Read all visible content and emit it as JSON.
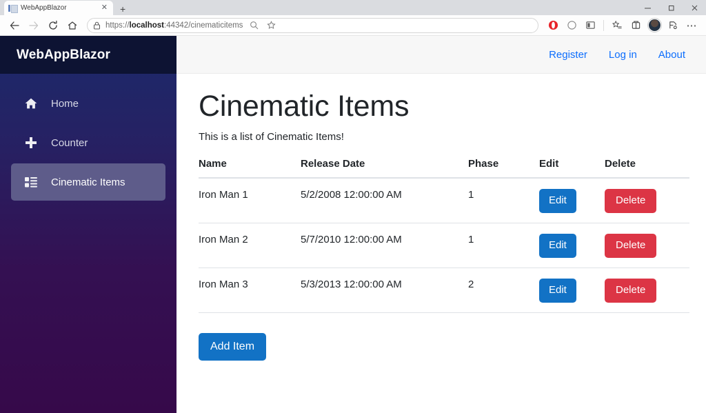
{
  "browser": {
    "tab": {
      "title": "WebAppBlazor",
      "close_label": "✕",
      "favicon": "document-icon"
    },
    "new_tab_label": "+",
    "window_controls": {
      "minimize": "minimize-icon",
      "maximize": "maximize-icon",
      "close": "close-icon"
    },
    "nav": {
      "back": "back-arrow-icon",
      "forward": "forward-arrow-icon",
      "refresh": "refresh-icon",
      "home": "home-icon"
    },
    "address": {
      "scheme": "https://",
      "host": "localhost",
      "rest": ":44342/cinematicitems",
      "full_url": "https://localhost:44342/cinematicitems",
      "lock": "lock-icon",
      "search_icon": "search-zoom-icon",
      "favorite_icon": "star-icon"
    },
    "extensions": [
      {
        "name": "opera-extension-icon",
        "color": "#E8242A"
      },
      {
        "name": "circle-extension-icon",
        "color": "#8a8a8a"
      },
      {
        "name": "panel-extension-icon",
        "color": "#5a5a5a"
      }
    ],
    "right_icons": [
      {
        "name": "collections-favorites-icon"
      },
      {
        "name": "browser-essentials-icon"
      },
      {
        "name": "profile-avatar"
      },
      {
        "name": "split-screen-icon"
      },
      {
        "name": "settings-more-icon",
        "label": "⋯"
      }
    ]
  },
  "app": {
    "brand": "WebAppBlazor",
    "topnav": [
      {
        "label": "Register",
        "name": "register-link"
      },
      {
        "label": "Log in",
        "name": "login-link"
      },
      {
        "label": "About",
        "name": "about-link"
      }
    ],
    "sidebar": {
      "items": [
        {
          "label": "Home",
          "icon": "house-icon",
          "active": false
        },
        {
          "label": "Counter",
          "icon": "plus-icon",
          "active": false
        },
        {
          "label": "Cinematic Items",
          "icon": "list-grid-icon",
          "active": true
        }
      ]
    },
    "page": {
      "title": "Cinematic Items",
      "subtitle": "This is a list of Cinematic Items!",
      "table": {
        "columns": [
          "Name",
          "Release Date",
          "Phase",
          "Edit",
          "Delete"
        ],
        "rows": [
          {
            "name": "Iron Man 1",
            "release_date": "5/2/2008 12:00:00 AM",
            "phase": "1",
            "edit": "Edit",
            "delete": "Delete"
          },
          {
            "name": "Iron Man 2",
            "release_date": "5/7/2010 12:00:00 AM",
            "phase": "1",
            "edit": "Edit",
            "delete": "Delete"
          },
          {
            "name": "Iron Man 3",
            "release_date": "5/3/2013 12:00:00 AM",
            "phase": "2",
            "edit": "Edit",
            "delete": "Delete"
          }
        ]
      },
      "add_button": "Add Item"
    }
  },
  "colors": {
    "brand_bar": "#0D1333",
    "sidebar_top": "#1B2A6B",
    "sidebar_bottom": "#36094A",
    "sidebar_active": "#5E5C8A",
    "link_blue": "#0d6efd",
    "btn_primary": "#1272C5",
    "btn_danger": "#DC3545"
  }
}
